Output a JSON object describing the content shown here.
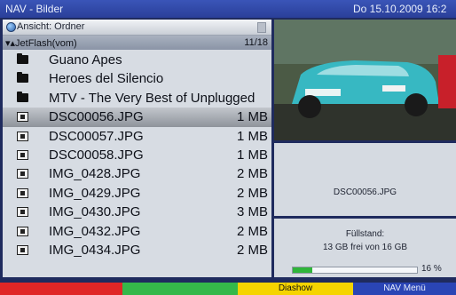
{
  "title": "NAV - Bilder",
  "clock": "Do 15.10.2009  16:2",
  "view": {
    "label": "Ansicht: Ordner"
  },
  "path": {
    "label": "▾▴JetFlash(vom)",
    "count": "11/18"
  },
  "items": [
    {
      "type": "folder",
      "name": "Guano Apes",
      "size": ""
    },
    {
      "type": "folder",
      "name": "Heroes del Silencio",
      "size": ""
    },
    {
      "type": "folder",
      "name": "MTV - The Very Best of Unplugged",
      "size": ""
    },
    {
      "type": "image",
      "name": "DSC00056.JPG",
      "size": "1 MB",
      "selected": true
    },
    {
      "type": "image",
      "name": "DSC00057.JPG",
      "size": "1 MB"
    },
    {
      "type": "image",
      "name": "DSC00058.JPG",
      "size": "1 MB"
    },
    {
      "type": "image",
      "name": "IMG_0428.JPG",
      "size": "2 MB"
    },
    {
      "type": "image",
      "name": "IMG_0429.JPG",
      "size": "2 MB"
    },
    {
      "type": "image",
      "name": "IMG_0430.JPG",
      "size": "3 MB"
    },
    {
      "type": "image",
      "name": "IMG_0432.JPG",
      "size": "2 MB"
    },
    {
      "type": "image",
      "name": "IMG_0434.JPG",
      "size": "2 MB"
    }
  ],
  "info": {
    "filename": "DSC00056.JPG"
  },
  "storage": {
    "label": "Füllstand:",
    "text": "13 GB frei von 16 GB",
    "percent_label": "16 %",
    "fill_percent": 16
  },
  "buttons": {
    "red": "",
    "green": "",
    "yellow": "Diashow",
    "blue": "NAV Menü"
  },
  "colors": {
    "titlebar": "#2a3f99",
    "selection": "#a9aeb5",
    "red": "#e02626",
    "green": "#35b84a",
    "yellow": "#f5d400",
    "blue": "#2a45b5",
    "progress": "#2fb53a"
  },
  "icons": {
    "view": "disc-icon",
    "folder": "folder-icon",
    "image": "image-file-icon"
  }
}
